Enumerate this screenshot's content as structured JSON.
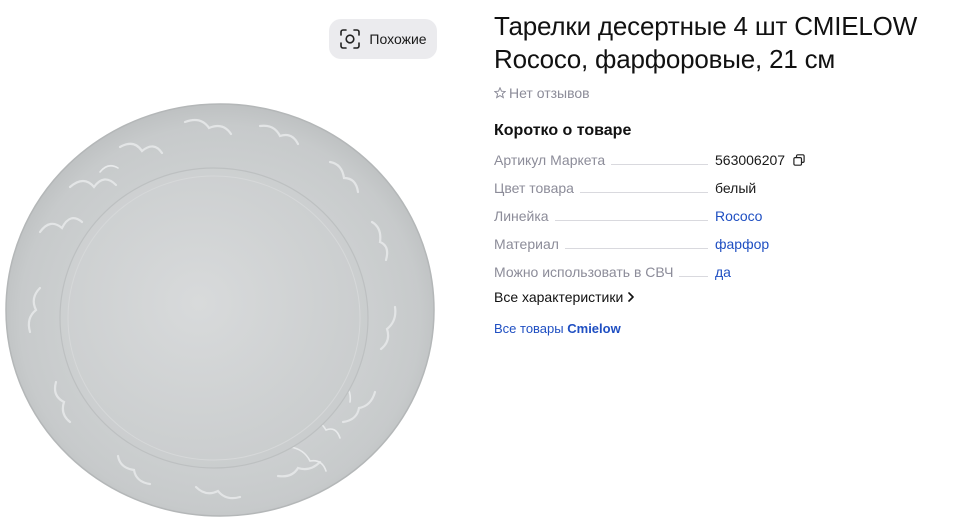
{
  "gallery": {
    "image_alt": "Тарелки десертные 4 шт CMIELOW Rococo",
    "similar_button": {
      "label": "Похожие",
      "icon": "scan-similar-icon"
    }
  },
  "product": {
    "title": "Тарелки десертные 4 шт CMIELOW Rococo, фарфоровые, 21 см",
    "reviews": {
      "label": "Нет отзывов",
      "icon": "star-outline-icon"
    }
  },
  "specs": {
    "heading": "Коротко о товаре",
    "items": [
      {
        "key": "Артикул Маркета",
        "value": "563006207",
        "link": false,
        "copy": true
      },
      {
        "key": "Цвет товара",
        "value": "белый",
        "link": false
      },
      {
        "key": "Линейка",
        "value": "Rococo",
        "link": true
      },
      {
        "key": "Материал",
        "value": "фарфор",
        "link": true
      },
      {
        "key": "Можно использовать в СВЧ",
        "value": "да",
        "link": true
      }
    ],
    "all_specs_link": "Все характеристики"
  },
  "brand_link": {
    "prefix": "Все товары",
    "brand": "Cmielow"
  },
  "colors": {
    "link": "#1f4fc2",
    "muted": "#8c8c99",
    "chip_bg": "#ebebee"
  }
}
